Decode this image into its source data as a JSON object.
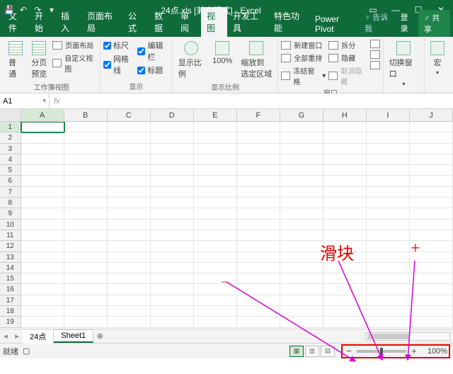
{
  "titlebar": {
    "title": "24点.xls [兼容模式] - Excel"
  },
  "tabs": {
    "file": "文件",
    "home": "开始",
    "insert": "插入",
    "layout": "页面布局",
    "formulas": "公式",
    "data": "数据",
    "review": "审阅",
    "view": "视图",
    "dev": "开发工具",
    "special": "特色功能",
    "powerpivot": "Power Pivot",
    "tellme": "告诉我",
    "login": "登录",
    "share": "共享"
  },
  "ribbon": {
    "normal": "普通",
    "pagebreak": "分页\n预览",
    "pagelayout": "页面布局",
    "customview": "自定义视图",
    "group_views": "工作簿视图",
    "ruler": "标尺",
    "gridlines": "网格线",
    "formulabar": "编辑栏",
    "headings": "标题",
    "group_show": "显示",
    "zoom": "显示比例",
    "hundred": "100%",
    "zoom_sel": "缩放到\n选定区域",
    "group_zoom": "显示比例",
    "newwin": "新建窗口",
    "arrange": "全部重排",
    "freeze": "冻结窗格",
    "split": "拆分",
    "hide": "隐藏",
    "unhide": "取消隐藏",
    "group_window": "窗口",
    "switch": "切换窗口",
    "macros": "宏"
  },
  "namebox": {
    "ref": "A1"
  },
  "columns": [
    "A",
    "B",
    "C",
    "D",
    "E",
    "F",
    "G",
    "H",
    "I",
    "J"
  ],
  "rows": [
    "1",
    "2",
    "3",
    "4",
    "5",
    "6",
    "7",
    "8",
    "9",
    "10",
    "11",
    "12",
    "13",
    "14",
    "15",
    "16",
    "17",
    "18",
    "19"
  ],
  "sheets": {
    "s1": "24点",
    "s2": "Sheet1"
  },
  "status": {
    "ready": "就绪",
    "zoom": "100%"
  },
  "anno": {
    "slider": "滑块",
    "plus": "+",
    "minus": "−"
  }
}
